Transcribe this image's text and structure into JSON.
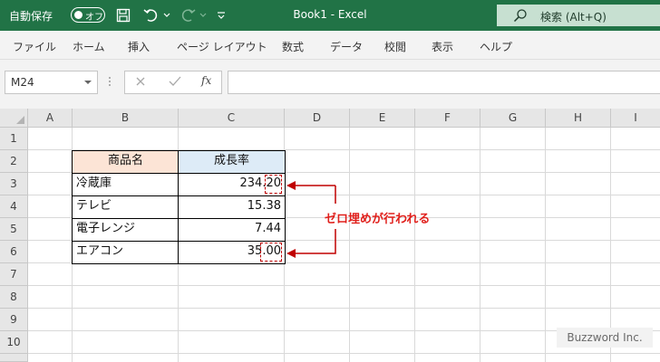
{
  "titlebar": {
    "autosave_label": "自動保存",
    "autosave_state": "オフ",
    "doc_title": "Book1  -  Excel",
    "search_placeholder": "検索 (Alt+Q)",
    "accent_color": "#217346"
  },
  "ribbon": {
    "tabs": [
      "ファイル",
      "ホーム",
      "挿入",
      "ページ レイアウト",
      "数式",
      "データ",
      "校閲",
      "表示",
      "ヘルプ"
    ]
  },
  "formula_bar": {
    "name_box": "M24",
    "fx_label": "fx",
    "formula_value": ""
  },
  "sheet": {
    "columns": [
      "A",
      "B",
      "C",
      "D",
      "E",
      "F",
      "G",
      "H",
      "I"
    ],
    "rows": [
      "1",
      "2",
      "3",
      "4",
      "5",
      "6",
      "7",
      "8",
      "9",
      "10"
    ],
    "table": {
      "header_b": "商品名",
      "header_c": "成長率",
      "header_b_color": "#fce4d6",
      "header_c_color": "#ddebf7",
      "rows": [
        {
          "name": "冷蔵庫",
          "value": "234.20"
        },
        {
          "name": "テレビ",
          "value": "15.38"
        },
        {
          "name": "電子レンジ",
          "value": "7.44"
        },
        {
          "name": "エアコン",
          "value": "35.00"
        }
      ]
    }
  },
  "annotation": {
    "text": "ゼロ埋めが行われる",
    "color": "#e0201c"
  },
  "watermark": "Buzzword Inc."
}
